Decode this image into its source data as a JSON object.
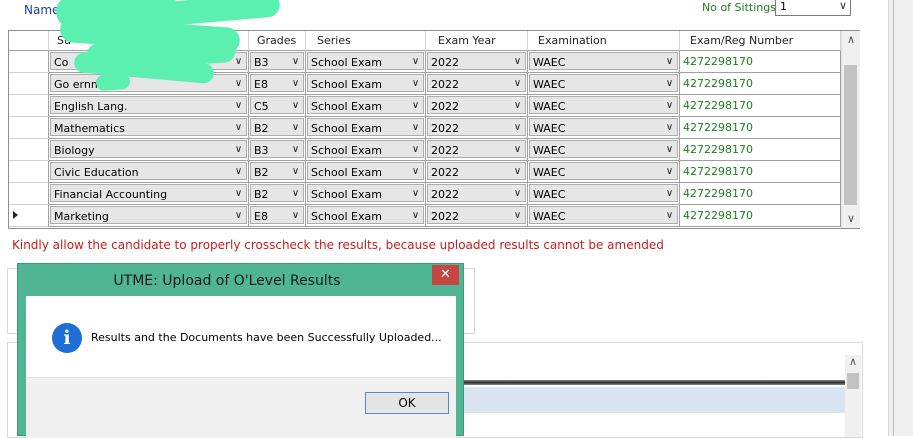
{
  "header": {
    "names_label": "Names",
    "sittings_label": "No of Sittings:",
    "sittings_value": "1"
  },
  "grid": {
    "columns": [
      "Su",
      "Grades",
      "Series",
      "Exam Year",
      "Examination",
      "Exam/Reg Number"
    ],
    "rows": [
      {
        "subject": "Co",
        "grade": "B3",
        "series": "School Exam",
        "year": "2022",
        "exam": "WAEC",
        "reg": "4272298170"
      },
      {
        "subject": "Go    ernment",
        "grade": "E8",
        "series": "School Exam",
        "year": "2022",
        "exam": "WAEC",
        "reg": "4272298170"
      },
      {
        "subject": "English Lang.",
        "grade": "C5",
        "series": "School Exam",
        "year": "2022",
        "exam": "WAEC",
        "reg": "4272298170"
      },
      {
        "subject": "Mathematics",
        "grade": "B2",
        "series": "School Exam",
        "year": "2022",
        "exam": "WAEC",
        "reg": "4272298170"
      },
      {
        "subject": "Biology",
        "grade": "B3",
        "series": "School Exam",
        "year": "2022",
        "exam": "WAEC",
        "reg": "4272298170"
      },
      {
        "subject": "Civic Education",
        "grade": "B2",
        "series": "School Exam",
        "year": "2022",
        "exam": "WAEC",
        "reg": "4272298170"
      },
      {
        "subject": "Financial Accounting",
        "grade": "B2",
        "series": "School Exam",
        "year": "2022",
        "exam": "WAEC",
        "reg": "4272298170"
      },
      {
        "subject": "Marketing",
        "grade": "E8",
        "series": "School Exam",
        "year": "2022",
        "exam": "WAEC",
        "reg": "4272298170"
      }
    ]
  },
  "warning": "Kindly allow the candidate to properly crosscheck the results, because uploaded results cannot be amended",
  "dialog": {
    "title": "UTME: Upload of O'Level Results",
    "close": "✕",
    "message": "Results and the Documents have been Successfully Uploaded...",
    "info_glyph": "i",
    "ok_label": "OK"
  },
  "colors": {
    "accent_green": "#1e7d1e",
    "warning_red": "#c41e1e",
    "dialog_frame": "#4fb593",
    "info_blue": "#1d6fd6",
    "redaction": "#5cf0b0"
  },
  "icons": {
    "dropdown": "chevron-down-icon",
    "info": "info-icon",
    "close": "close-icon"
  }
}
